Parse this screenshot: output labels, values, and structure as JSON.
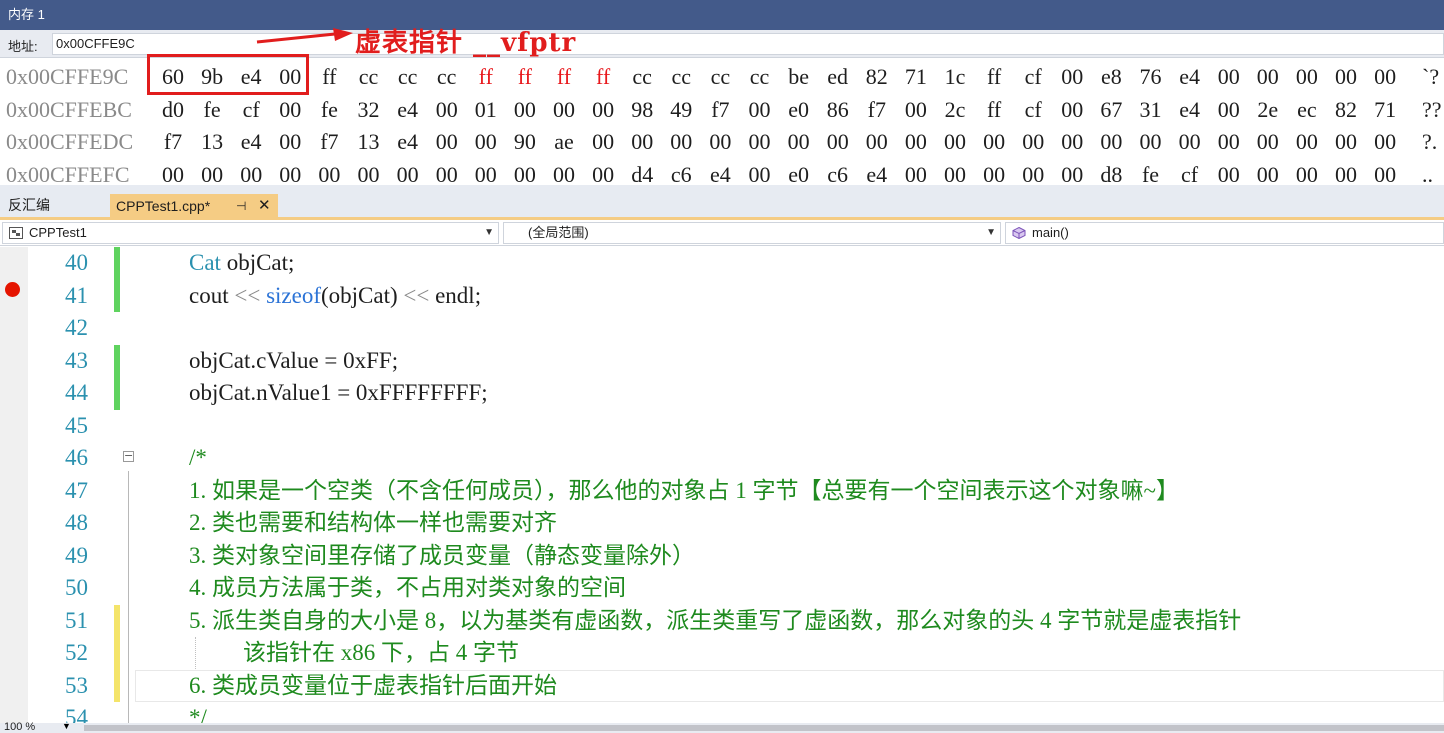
{
  "memory": {
    "title": "内存 1",
    "address_label": "地址:",
    "address_value": "0x00CFFE9C",
    "rows": [
      {
        "addr": "0x00CFFE9C",
        "bytes": [
          "60",
          "9b",
          "e4",
          "00",
          "ff",
          "cc",
          "cc",
          "cc",
          "ff",
          "ff",
          "ff",
          "ff",
          "cc",
          "cc",
          "cc",
          "cc",
          "be",
          "ed",
          "82",
          "71",
          "1c",
          "ff",
          "cf",
          "00",
          "e8",
          "76",
          "e4",
          "00",
          "00",
          "00",
          "00",
          "00"
        ],
        "changed": [
          8,
          9,
          10,
          11
        ],
        "ascii": "`?"
      },
      {
        "addr": "0x00CFFEBC",
        "bytes": [
          "d0",
          "fe",
          "cf",
          "00",
          "fe",
          "32",
          "e4",
          "00",
          "01",
          "00",
          "00",
          "00",
          "98",
          "49",
          "f7",
          "00",
          "e0",
          "86",
          "f7",
          "00",
          "2c",
          "ff",
          "cf",
          "00",
          "67",
          "31",
          "e4",
          "00",
          "2e",
          "ec",
          "82",
          "71"
        ],
        "changed": [],
        "ascii": "??"
      },
      {
        "addr": "0x00CFFEDC",
        "bytes": [
          "f7",
          "13",
          "e4",
          "00",
          "f7",
          "13",
          "e4",
          "00",
          "00",
          "90",
          "ae",
          "00",
          "00",
          "00",
          "00",
          "00",
          "00",
          "00",
          "00",
          "00",
          "00",
          "00",
          "00",
          "00",
          "00",
          "00",
          "00",
          "00",
          "00",
          "00",
          "00",
          "00"
        ],
        "changed": [],
        "ascii": "?."
      },
      {
        "addr": "0x00CFFEFC",
        "bytes": [
          "00",
          "00",
          "00",
          "00",
          "00",
          "00",
          "00",
          "00",
          "00",
          "00",
          "00",
          "00",
          "d4",
          "c6",
          "e4",
          "00",
          "e0",
          "c6",
          "e4",
          "00",
          "00",
          "00",
          "00",
          "00",
          "d8",
          "fe",
          "cf",
          "00",
          "00",
          "00",
          "00",
          "00"
        ],
        "changed": [],
        "ascii": ".."
      }
    ],
    "annotation": "虚表指针 __vfptr",
    "highlight_color": "#e11d1d"
  },
  "tabs": {
    "disassembly": "反汇编",
    "active_file": "CPPTest1.cpp*",
    "pin_icon": "⊣",
    "close_icon": "✕"
  },
  "nav": {
    "project": "CPPTest1",
    "scope": "(全局范围)",
    "member": "main()"
  },
  "editor": {
    "lines": [
      {
        "num": "40",
        "change": "green",
        "parts": [
          [
            "typ",
            "Cat"
          ],
          [
            "plain",
            " objCat;"
          ]
        ]
      },
      {
        "num": "41",
        "change": "green",
        "breakpoint": true,
        "parts": [
          [
            "plain",
            "cout "
          ],
          [
            "op",
            "<<"
          ],
          [
            "plain",
            " "
          ],
          [
            "kw",
            "sizeof"
          ],
          [
            "plain",
            "(objCat) "
          ],
          [
            "op",
            "<<"
          ],
          [
            "plain",
            " endl;"
          ]
        ]
      },
      {
        "num": "42",
        "change": "",
        "parts": []
      },
      {
        "num": "43",
        "change": "green",
        "parts": [
          [
            "plain",
            "objCat.cValue = 0xFF;"
          ]
        ]
      },
      {
        "num": "44",
        "change": "green",
        "parts": [
          [
            "plain",
            "objCat.nValue1 = 0xFFFFFFFF;"
          ]
        ]
      },
      {
        "num": "45",
        "change": "",
        "parts": []
      },
      {
        "num": "46",
        "change": "",
        "fold": true,
        "parts": [
          [
            "cmt",
            "/*"
          ]
        ]
      },
      {
        "num": "47",
        "change": "",
        "parts": [
          [
            "cmt",
            "1. 如果是一个空类（不含任何成员），那么他的对象占 1 字节【总要有一个空间表示这个对象嘛~】"
          ]
        ]
      },
      {
        "num": "48",
        "change": "",
        "parts": [
          [
            "cmt",
            "2. 类也需要和结构体一样也需要对齐"
          ]
        ]
      },
      {
        "num": "49",
        "change": "",
        "parts": [
          [
            "cmt",
            "3. 类对象空间里存储了成员变量（静态变量除外）"
          ]
        ]
      },
      {
        "num": "50",
        "change": "",
        "parts": [
          [
            "cmt",
            "4. 成员方法属于类，不占用对类对象的空间"
          ]
        ]
      },
      {
        "num": "51",
        "change": "yellow",
        "parts": [
          [
            "cmt",
            "5. 派生类自身的大小是 8，以为基类有虚函数，派生类重写了虚函数，那么对象的头 4 字节就是虚表指针"
          ]
        ]
      },
      {
        "num": "52",
        "change": "yellow",
        "cont": true,
        "parts": [
          [
            "cmt",
            "该指针在 x86 下，占 4 字节"
          ]
        ]
      },
      {
        "num": "53",
        "change": "yellow",
        "parts": [
          [
            "cmt",
            "6. 类成员变量位于虚表指针后面开始"
          ]
        ]
      },
      {
        "num": "54",
        "change": "",
        "parts": [
          [
            "cmt",
            "*/"
          ]
        ]
      }
    ]
  },
  "status": {
    "zoom": "100 %"
  }
}
